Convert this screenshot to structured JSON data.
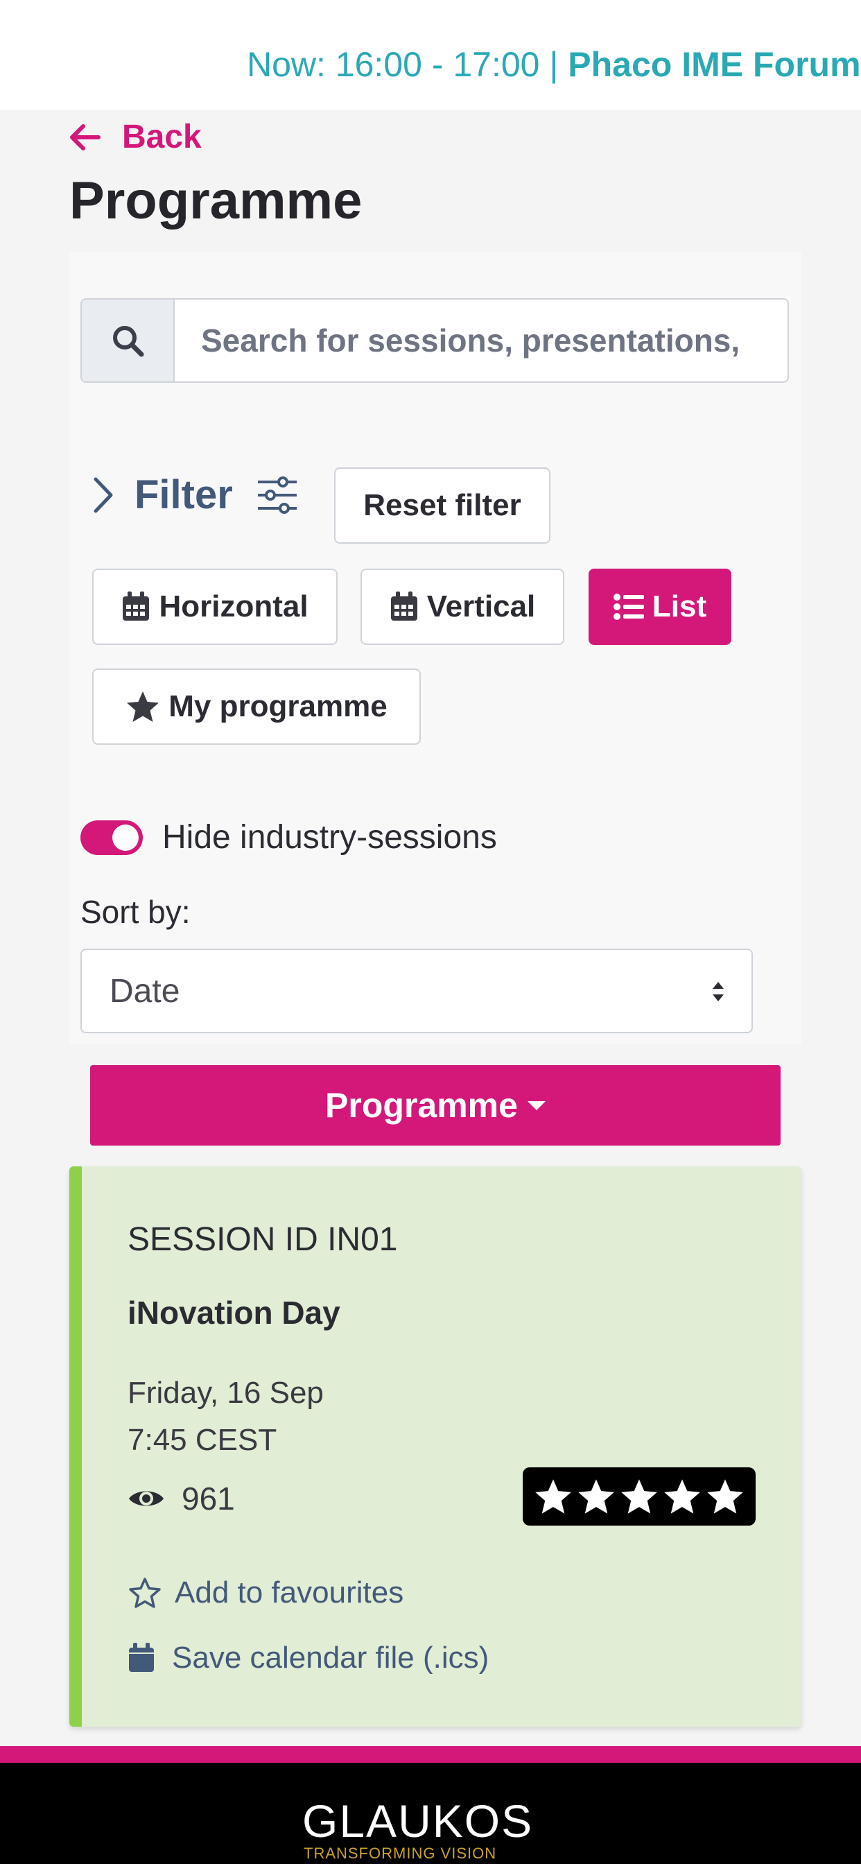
{
  "ticker": {
    "prefix": "Now: 16:00 - 17:00 |",
    "session": "Phaco IME Forum"
  },
  "nav": {
    "back_label": "Back"
  },
  "page": {
    "title": "Programme"
  },
  "search": {
    "placeholder": "Search for sessions, presentations,"
  },
  "filter": {
    "label": "Filter",
    "reset_label": "Reset filter"
  },
  "views": {
    "horizontal_label": "Horizontal",
    "vertical_label": "Vertical",
    "list_label": "List",
    "my_programme_label": "My programme",
    "active": "List"
  },
  "toggle": {
    "label": "Hide industry-sessions",
    "checked": true
  },
  "sort": {
    "label": "Sort by:",
    "selected": "Date"
  },
  "programme_button": {
    "label": "Programme"
  },
  "session": {
    "id_label": "SESSION ID IN01",
    "title": "iNovation Day",
    "date": "Friday, 16 Sep",
    "time": "7:45 CEST",
    "views": "961",
    "rating": 5,
    "favourite_label": "Add to favourites",
    "calendar_label": "Save calendar file (.ics)"
  },
  "footer": {
    "logo_text": "GLAUKOS",
    "tagline": "TRANSFORMING VISION"
  },
  "colors": {
    "accent": "#d3187a",
    "teal": "#2aa9b5",
    "session_bg": "#e1edd4",
    "session_border": "#8ed04a",
    "slate": "#43597a"
  }
}
